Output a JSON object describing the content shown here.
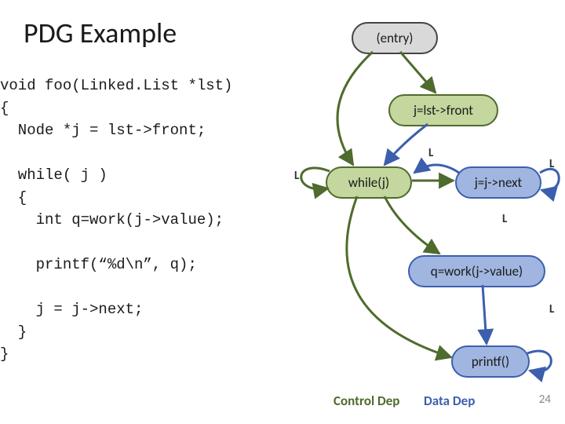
{
  "title": "PDG Example",
  "code": "void foo(Linked.List *lst)\n{\n  Node *j = lst->front;\n\n  while( j )\n  {\n    int q=work(j->value);\n\n    printf(“%d\\n”, q);\n\n    j = j->next;\n  }\n}",
  "nodes": {
    "entry": "(entry)",
    "jfront": "j=lst->front",
    "whilej": "while(j)",
    "jnext": "j=j->next",
    "qwork": "q=work(j->value)",
    "printf": "printf()"
  },
  "labels": {
    "L1": "L",
    "L2": "L",
    "L3": "L",
    "L4": "L",
    "L5": "L"
  },
  "legend": {
    "control": "Control Dep",
    "data": "Data Dep"
  },
  "page_number": "24",
  "colors": {
    "control": "#4f6b2d",
    "data": "#3c5fad"
  },
  "chart_data": {
    "type": "graph",
    "nodes": [
      "entry",
      "j=lst->front",
      "while(j)",
      "j=j->next",
      "q=work(j->value)",
      "printf()"
    ],
    "control_edges": [
      [
        "entry",
        "j=lst->front"
      ],
      [
        "entry",
        "while(j)"
      ],
      [
        "while(j)",
        "while(j)"
      ],
      [
        "while(j)",
        "j=j->next"
      ],
      [
        "while(j)",
        "q=work(j->value)"
      ],
      [
        "while(j)",
        "printf()"
      ]
    ],
    "data_edges": [
      [
        "j=lst->front",
        "while(j)"
      ],
      [
        "j=j->next",
        "while(j)"
      ],
      [
        "j=j->next",
        "j=j->next"
      ],
      [
        "q=work(j->value)",
        "printf()"
      ],
      [
        "printf()",
        "printf()"
      ]
    ],
    "loop_labels": [
      "L",
      "L",
      "L",
      "L",
      "L"
    ]
  }
}
